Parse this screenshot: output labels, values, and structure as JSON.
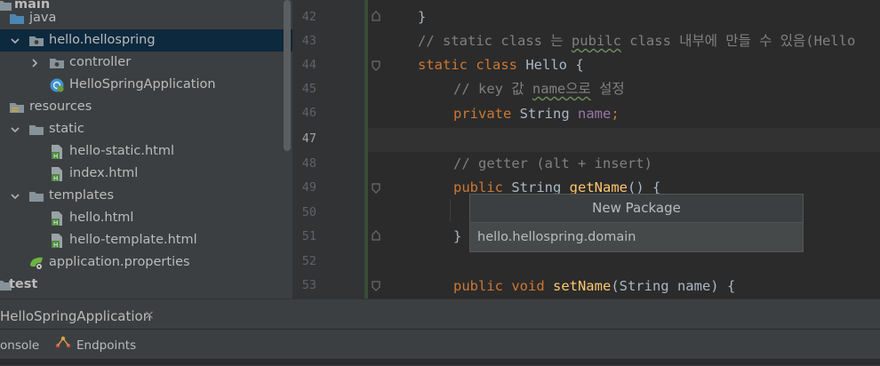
{
  "project_tree": {
    "items": [
      {
        "label": "main",
        "icon": "folder-icon"
      },
      {
        "label": "java",
        "icon": "source-folder-icon"
      },
      {
        "label": "hello.hellospring",
        "icon": "package-icon",
        "expanded": true,
        "selected": true
      },
      {
        "label": "controller",
        "icon": "package-icon",
        "expanded": false
      },
      {
        "label": "HelloSpringApplication",
        "icon": "spring-boot-class-icon"
      },
      {
        "label": "resources",
        "icon": "resources-folder-icon"
      },
      {
        "label": "static",
        "icon": "folder-icon",
        "expanded": true
      },
      {
        "label": "hello-static.html",
        "icon": "html-file-icon"
      },
      {
        "label": "index.html",
        "icon": "html-file-icon"
      },
      {
        "label": "templates",
        "icon": "folder-icon",
        "expanded": true
      },
      {
        "label": "hello.html",
        "icon": "html-file-icon"
      },
      {
        "label": "hello-template.html",
        "icon": "html-file-icon"
      },
      {
        "label": "application.properties",
        "icon": "spring-properties-icon"
      },
      {
        "label": "test",
        "icon": "folder-icon"
      }
    ]
  },
  "editor": {
    "line_numbers": [
      "42",
      "43",
      "44",
      "45",
      "46",
      "47",
      "48",
      "49",
      "50",
      "51",
      "52",
      "53"
    ],
    "current_line": "47",
    "code": {
      "l42": "}",
      "l43_comment_a": "// static class 는 ",
      "l43_comment_typo": "pubilc",
      "l43_comment_b": " class 내부에 만들 수 있음(Hello",
      "l44_kw": "static class ",
      "l44_rest": "Hello {",
      "l45_a": "// key 값 ",
      "l45_typo": "name으로",
      "l45_b": " 설정",
      "l46_kw": "private ",
      "l46_type": "String ",
      "l46_field": "name",
      "l46_semi": ";",
      "l48": "// getter (alt + insert)",
      "l49_kw": "public ",
      "l49_type": "String ",
      "l49_fn": "getName",
      "l49_rest": "() {",
      "l51": "}",
      "l53_kw": "public void ",
      "l53_fn": "setName",
      "l53_rest": "(String name) {"
    }
  },
  "popup": {
    "title": "New Package",
    "value": "hello.hellospring.domain"
  },
  "run_panel": {
    "tab_label": "HelloSpringApplication",
    "close_glyph": "×"
  },
  "tool_window": {
    "console_label": "onsole",
    "endpoints_label": "Endpoints"
  },
  "colors": {
    "tree_bg": "#3c3f41",
    "editor_bg": "#2b2b2b",
    "keyword": "#cc7832",
    "comment": "#808080",
    "field": "#9876aa",
    "function": "#ffc66d",
    "selection": "#0d293e"
  }
}
